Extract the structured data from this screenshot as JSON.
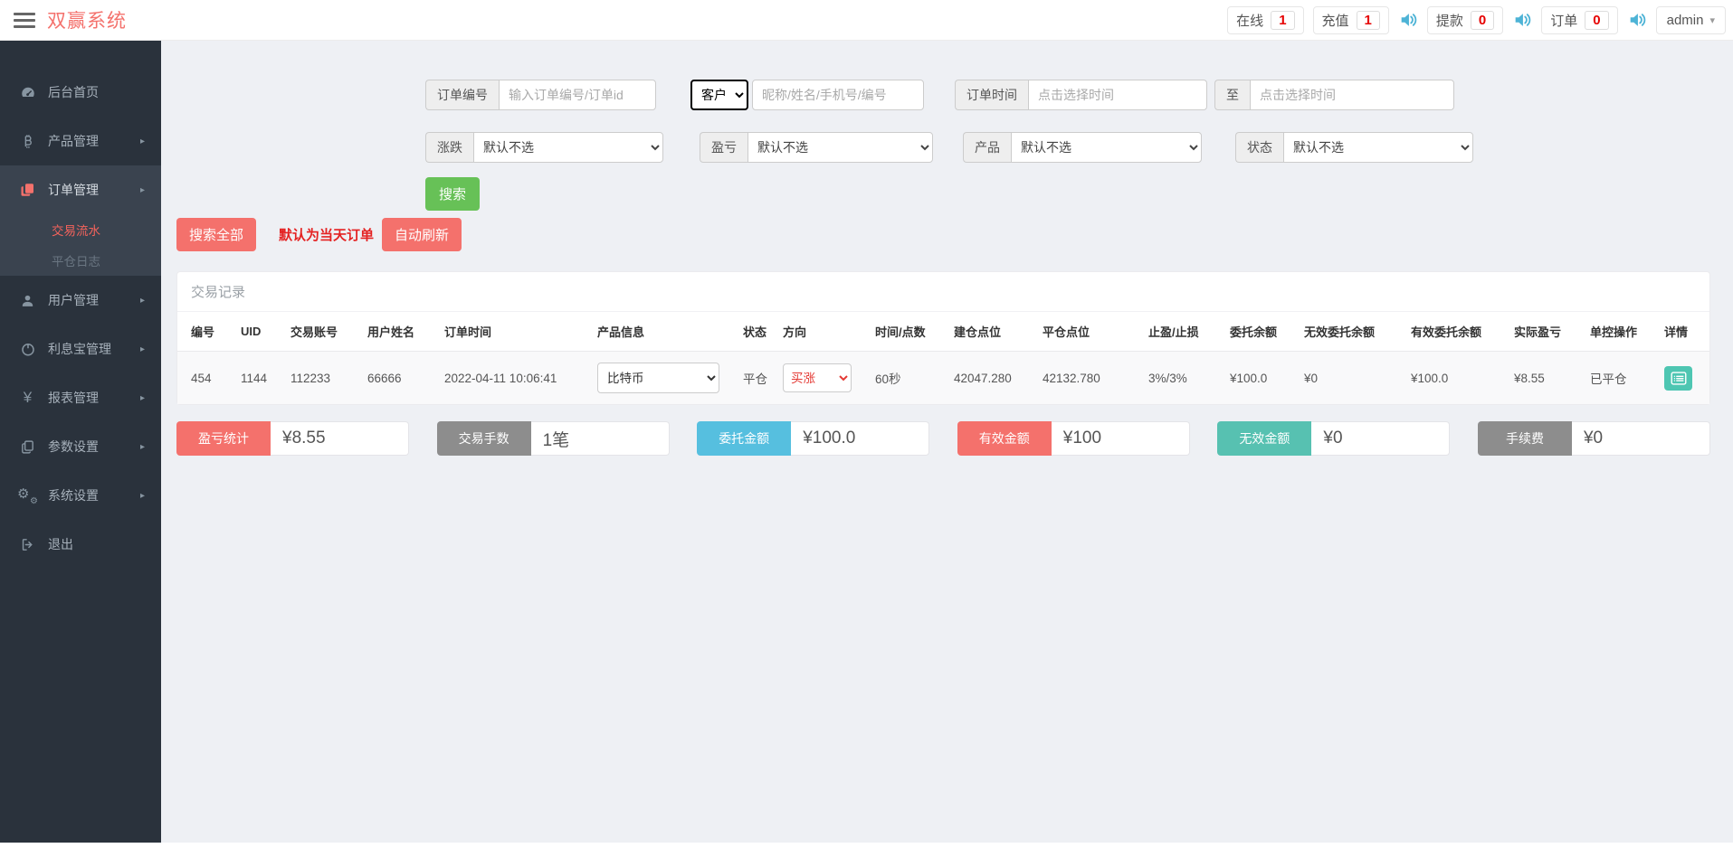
{
  "header": {
    "brand": "双赢系统",
    "stats": [
      {
        "label": "在线",
        "value": "1",
        "icon": null
      },
      {
        "label": "充值",
        "value": "1",
        "icon": "speaker-icon"
      },
      {
        "label": "提款",
        "value": "0",
        "icon": "speaker-icon"
      },
      {
        "label": "订单",
        "value": "0",
        "icon": "speaker-icon"
      }
    ],
    "user": "admin",
    "number_color": "#e60000",
    "sound_icon_color": "#4db3d6"
  },
  "sidebar": {
    "items": [
      {
        "label": "后台首页",
        "icon": "gauge-icon"
      },
      {
        "label": "产品管理",
        "icon": "bitcoin-icon"
      },
      {
        "label": "订单管理",
        "icon": "orders-copy-icon"
      },
      {
        "label": "交易流水",
        "icon": null
      },
      {
        "label": "平仓日志",
        "icon": null
      },
      {
        "label": "用户管理",
        "icon": "user-icon"
      },
      {
        "label": "利息宝管理",
        "icon": "power-circle-icon"
      },
      {
        "label": "报表管理",
        "icon": "yen-icon"
      },
      {
        "label": "参数设置",
        "icon": "copy-outline-icon"
      },
      {
        "label": "系统设置",
        "icon": "gears-icon"
      },
      {
        "label": "退出",
        "icon": "logout-icon"
      }
    ],
    "active_parent": "订单管理",
    "active_sub": "交易流水"
  },
  "filters": {
    "order_no": {
      "label": "订单编号",
      "placeholder": "输入订单编号/订单id"
    },
    "customer": {
      "selected": "客户",
      "placeholder": "昵称/姓名/手机号/编号"
    },
    "order_time": {
      "label": "订单时间",
      "placeholder": "点击选择时间"
    },
    "to": {
      "label": "至",
      "placeholder": "点击选择时间"
    },
    "updown": {
      "label": "涨跌",
      "selected": "默认不选"
    },
    "profit": {
      "label": "盈亏",
      "selected": "默认不选"
    },
    "product": {
      "label": "产品",
      "selected": "默认不选"
    },
    "status": {
      "label": "状态",
      "selected": "默认不选"
    },
    "search_label": "搜索"
  },
  "actions": {
    "search_all": "搜索全部",
    "note": "默认为当天订单",
    "auto_refresh": "自动刷新"
  },
  "panel": {
    "title": "交易记录",
    "columns": [
      "编号",
      "UID",
      "交易账号",
      "用户姓名",
      "订单时间",
      "产品信息",
      "状态",
      "方向",
      "时间/点数",
      "建仓点位",
      "平仓点位",
      "止盈/止损",
      "委托余额",
      "无效委托余额",
      "有效委托余额",
      "实际盈亏",
      "单控操作",
      "详情"
    ],
    "row": {
      "id": "454",
      "uid": "1144",
      "account": "112233",
      "name": "66666",
      "time": "2022-04-11 10:06:41",
      "product": "比特币",
      "status": "平仓",
      "direction": "买涨",
      "duration": "60秒",
      "open_price": "42047.280",
      "close_price": "42132.780",
      "tp_sl": "3%/3%",
      "entrust_balance": "¥100.0",
      "invalid_entrust": "¥0",
      "valid_entrust": "¥100.0",
      "actual_profit": "¥8.55",
      "control": "已平仓",
      "detail_icon": "list-detail-icon"
    }
  },
  "summary": [
    {
      "label": "盈亏统计",
      "value": "¥8.55",
      "color": "#f4716c"
    },
    {
      "label": "交易手数",
      "value": "1笔",
      "color": "#8d8d8d"
    },
    {
      "label": "委托金额",
      "value": "¥100.0",
      "color": "#56bfdf"
    },
    {
      "label": "有效金额",
      "value": "¥100",
      "color": "#f4716c"
    },
    {
      "label": "无效金额",
      "value": "¥0",
      "color": "#57c1b1"
    },
    {
      "label": "手续费",
      "value": "¥0",
      "color": "#8d8d8d"
    }
  ]
}
